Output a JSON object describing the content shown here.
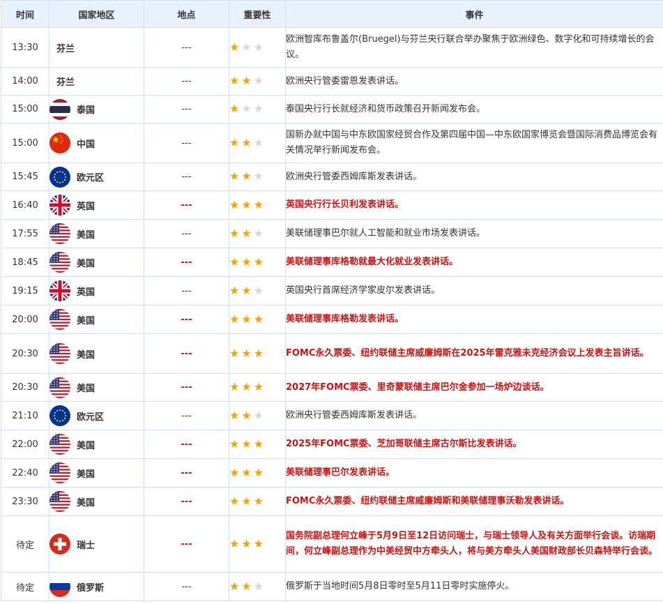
{
  "headers": {
    "time": "时间",
    "region": "国家地区",
    "location": "地点",
    "importance": "重要性",
    "event": "事件"
  },
  "colors": {
    "header_bg": "#e8f2fc",
    "border": "#cfe0f1",
    "highlight_text": "#cc1111",
    "star_on": "#f5a300",
    "star_off": "#d7d7d7"
  },
  "rows": [
    {
      "time": "13:30",
      "region": "芬兰",
      "flag": "none",
      "location": "---",
      "stars": 1,
      "highlight": false,
      "event": "欧洲智库布鲁盖尔(Bruegel)与芬兰央行联合举办聚焦于欧洲绿色、数字化和可持续增长的会议。"
    },
    {
      "time": "14:00",
      "region": "芬兰",
      "flag": "none",
      "location": "---",
      "stars": 2,
      "highlight": false,
      "event": "欧洲央行管委雷恩发表讲话。"
    },
    {
      "time": "15:00",
      "region": "泰国",
      "flag": "thailand-flag-icon",
      "location": "---",
      "stars": 1,
      "highlight": false,
      "event": "泰国央行行长就经济和货币政策召开新闻发布会。"
    },
    {
      "time": "15:00",
      "region": "中国",
      "flag": "china-flag-icon",
      "location": "---",
      "stars": 2,
      "highlight": false,
      "event": "国新办就中国与中东欧国家经贸合作及第四届中国—中东欧国家博览会暨国际消费品博览会有关情况举行新闻发布会。"
    },
    {
      "time": "15:45",
      "region": "欧元区",
      "flag": "eu-flag-icon",
      "location": "---",
      "stars": 2,
      "highlight": false,
      "event": "欧洲央行管委西姆库斯发表讲话。"
    },
    {
      "time": "16:40",
      "region": "英国",
      "flag": "uk-flag-icon",
      "location": "---",
      "stars": 3,
      "highlight": true,
      "event": "英国央行行长贝利发表讲话。"
    },
    {
      "time": "17:55",
      "region": "美国",
      "flag": "us-flag-icon",
      "location": "---",
      "stars": 2,
      "highlight": false,
      "event": "美联储理事巴尔就人工智能和就业市场发表讲话。"
    },
    {
      "time": "18:45",
      "region": "美国",
      "flag": "us-flag-icon",
      "location": "---",
      "stars": 3,
      "highlight": true,
      "event": "美联储理事库格勒就最大化就业发表讲话。"
    },
    {
      "time": "19:15",
      "region": "英国",
      "flag": "uk-flag-icon",
      "location": "---",
      "stars": 2,
      "highlight": false,
      "event": "英国央行首席经济学家皮尔发表讲话。"
    },
    {
      "time": "20:00",
      "region": "美国",
      "flag": "us-flag-icon",
      "location": "---",
      "stars": 3,
      "highlight": true,
      "event": "美联储理事库格勒发表讲话。"
    },
    {
      "time": "20:30",
      "region": "美国",
      "flag": "us-flag-icon",
      "location": "---",
      "stars": 3,
      "highlight": true,
      "event": "FOMC永久票委、纽约联储主席威廉姆斯在2025年雷克雅未克经济会议上发表主旨讲话。"
    },
    {
      "time": "20:30",
      "region": "美国",
      "flag": "us-flag-icon",
      "location": "---",
      "stars": 3,
      "highlight": true,
      "event": "2027年FOMC票委、里奇蒙联储主席巴尔金参加一场炉边谈话。"
    },
    {
      "time": "21:10",
      "region": "欧元区",
      "flag": "eu-flag-icon",
      "location": "---",
      "stars": 2,
      "highlight": false,
      "event": "欧洲央行管委西姆库斯发表讲话。"
    },
    {
      "time": "22:00",
      "region": "美国",
      "flag": "us-flag-icon",
      "location": "---",
      "stars": 3,
      "highlight": true,
      "event": "2025年FOMC票委、芝加哥联储主席古尔斯比发表讲话。"
    },
    {
      "time": "22:40",
      "region": "美国",
      "flag": "us-flag-icon",
      "location": "---",
      "stars": 3,
      "highlight": true,
      "event": "美联储理事巴尔发表讲话。"
    },
    {
      "time": "23:30",
      "region": "美国",
      "flag": "us-flag-icon",
      "location": "---",
      "stars": 3,
      "highlight": true,
      "event": "FOMC永久票委、纽约联储主席威廉姆斯和美联储理事沃勒发表讲话。"
    },
    {
      "time": "待定",
      "region": "瑞士",
      "flag": "switzerland-flag-icon",
      "location": "---",
      "stars": 3,
      "highlight": true,
      "event": "国务院副总理何立峰于5月9日至12日访问瑞士，与瑞士领导人及有关方面举行会谈。访瑞期间，何立峰副总理作为中美经贸中方牵头人，将与美方牵头人美国财政部长贝森特举行会谈。"
    },
    {
      "time": "待定",
      "region": "俄罗斯",
      "flag": "russia-flag-icon",
      "location": "---",
      "stars": 2,
      "highlight": false,
      "event": "俄罗斯于当地时间5月8日零时至5月11日零时实施停火。"
    }
  ]
}
